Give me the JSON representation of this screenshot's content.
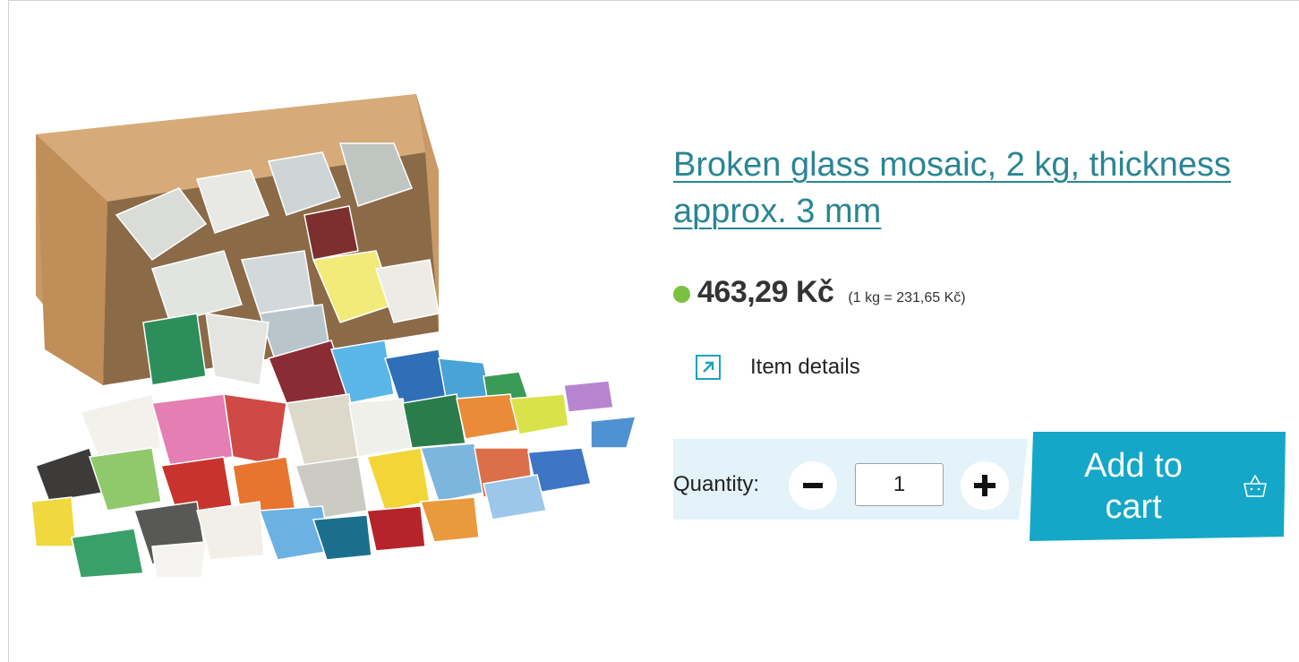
{
  "product": {
    "title": "Broken glass mosaic, 2 kg, thickness approx. 3 mm",
    "price": "463,29 Kč",
    "unit_price": "(1 kg = 231,65 Kč)",
    "stock_status_color": "#7bc043",
    "details_label": "Item details"
  },
  "order": {
    "quantity_label": "Quantity:",
    "quantity_value": "1",
    "minus_icon": "minus-icon",
    "plus_icon": "plus-icon",
    "add_to_cart_label": "Add to cart",
    "cart_icon": "basket-icon"
  },
  "colors": {
    "accent": "#14a7c7",
    "title_link": "#2a8594",
    "quantity_panel": "#e3f3f9"
  }
}
